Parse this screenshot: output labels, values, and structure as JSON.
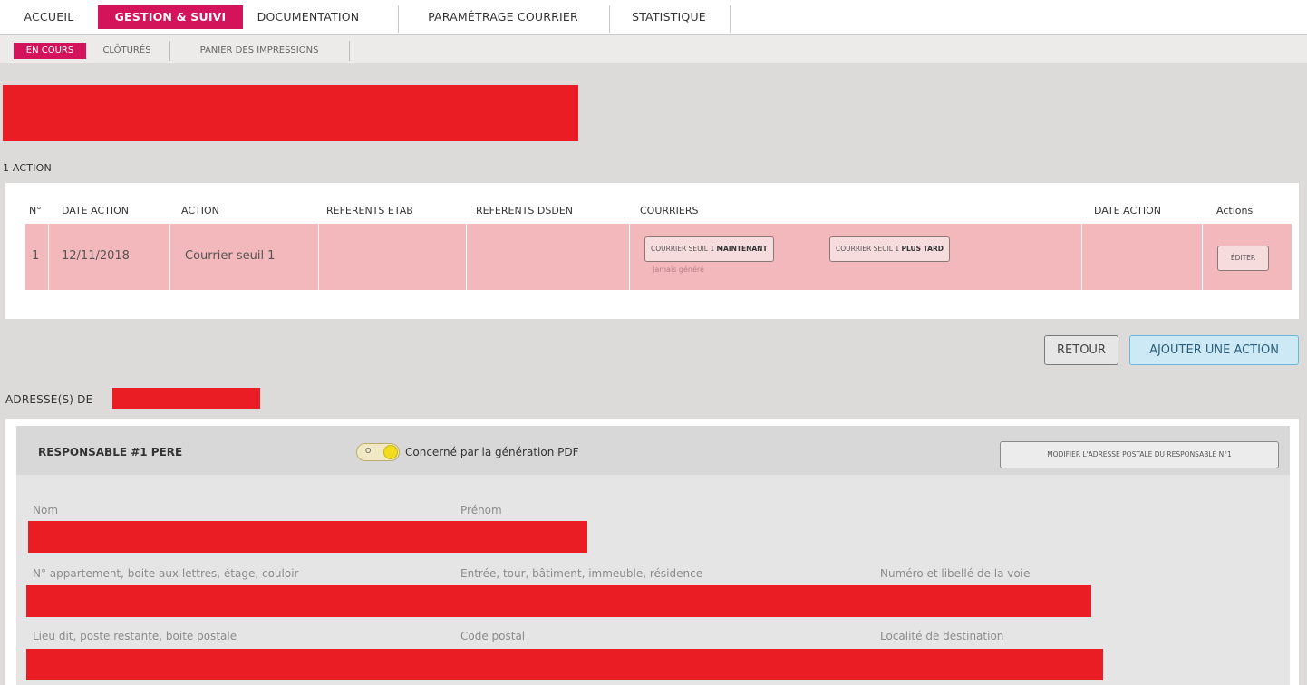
{
  "topnav": {
    "tabs": [
      {
        "label": "ACCUEIL"
      },
      {
        "label": "GESTION & SUIVI"
      },
      {
        "label": "DOCUMENTATION"
      },
      {
        "label": "PARAMÉTRAGE COURRIER"
      },
      {
        "label": "STATISTIQUE"
      }
    ],
    "active_color": "#d4145a"
  },
  "subnav": {
    "tabs": [
      {
        "label": "EN COURS"
      },
      {
        "label": "CLÔTURÉS"
      },
      {
        "label": "PANIER DES IMPRESSIONS"
      }
    ]
  },
  "actions": {
    "count_label": "1 ACTION",
    "columns": [
      "N°",
      "DATE ACTION",
      "ACTION",
      "REFERENTS ETAB",
      "REFERENTS DSDEN",
      "COURRIERS",
      "DATE ACTION",
      "Actions"
    ],
    "rows": [
      {
        "num": "1",
        "date": "12/11/2018",
        "action": "Courrier seuil 1",
        "referents_etab": "",
        "referents_dsden": "",
        "courrier_now_prefix": "COURRIER SEUIL 1",
        "courrier_now_bold": "MAINTENANT",
        "courrier_later_prefix": "COURRIER SEUIL 1",
        "courrier_later_bold": "PLUS TARD",
        "courrier_note": "Jamais généré",
        "date_action2": "",
        "edit_label": "ÉDITER"
      }
    ],
    "row_color": "#f3b8bb"
  },
  "buttons": {
    "retour": "RETOUR",
    "ajouter": "AJOUTER UNE ACTION"
  },
  "address": {
    "heading_prefix": "ADRESSE(S) DE",
    "responsable_title": "RESPONSABLE #1 PERE",
    "toggle_off_label": "O",
    "toggle_state": "on",
    "toggle_label": "Concerné par la génération PDF",
    "modify_button": "MODIFIER L'ADRESSE POSTALE DU RESPONSABLE N°1",
    "fields": {
      "nom": "Nom",
      "prenom": "Prénom",
      "appartement": "N° appartement, boite aux lettres, étage, couloir",
      "entree": "Entrée, tour, bâtiment, immeuble, résidence",
      "voie": "Numéro et libellé de la voie",
      "lieu_dit": "Lieu dit, poste restante, boite postale",
      "code_postal": "Code postal",
      "localite": "Localité de destination"
    }
  }
}
